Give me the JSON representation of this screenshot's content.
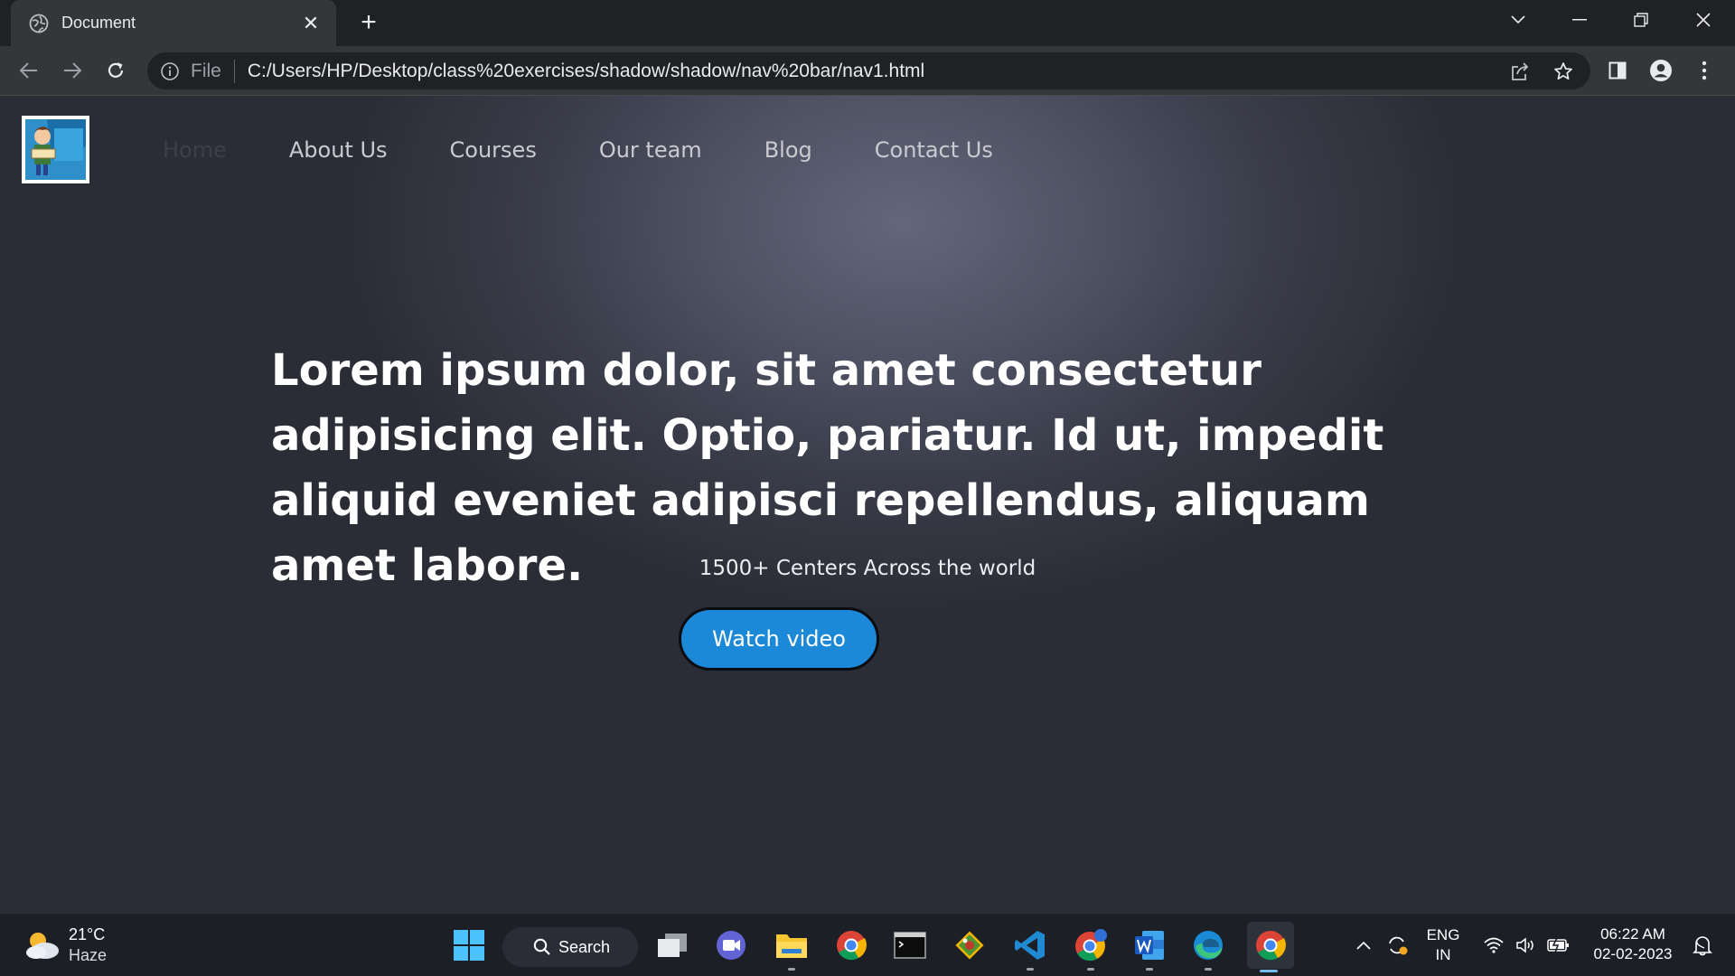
{
  "browser": {
    "tab_title": "Document",
    "url_scheme": "File",
    "url": "C:/Users/HP/Desktop/class%20exercises/shadow/shadow/nav%20bar/nav1.html"
  },
  "page": {
    "nav": [
      "Home",
      "About Us",
      "Courses",
      "Our team",
      "Blog",
      "Contact Us"
    ],
    "active_nav": "Home",
    "hero_title": "Lorem ipsum dolor, sit amet consectetur adipisicing elit. Optio, pariatur. Id ut, impedit aliquid eveniet adipisci repellendus, aliquam amet labore.",
    "hero_subtitle": "1500+ Centers Across the world",
    "cta_label": "Watch video",
    "colors": {
      "cta": "#1c88d8",
      "hero_bg": "#4e5263",
      "active_nav": "#3d3f48"
    }
  },
  "taskbar": {
    "weather_temp": "21°C",
    "weather_condition": "Haze",
    "search_label": "Search",
    "language_line1": "ENG",
    "language_line2": "IN",
    "time": "06:22 AM",
    "date": "02-02-2023",
    "apps": [
      "start-icon",
      "search-icon",
      "task-view-icon",
      "teams-icon",
      "file-explorer-icon",
      "chrome-icon",
      "terminal-icon",
      "git-icon",
      "vscode-icon",
      "chrome-canary-icon",
      "word-icon",
      "edge-icon",
      "chrome-icon"
    ]
  }
}
